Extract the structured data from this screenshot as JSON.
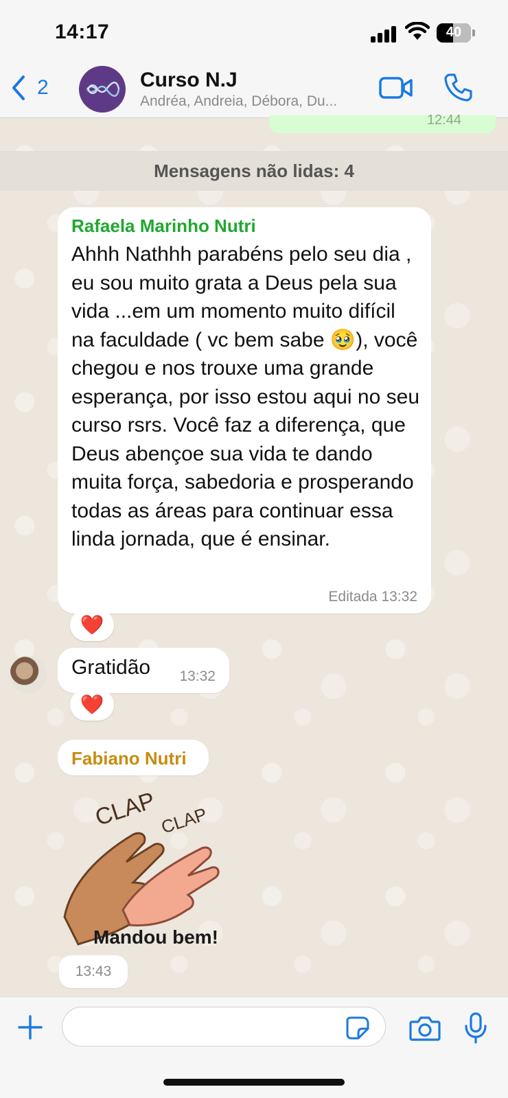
{
  "status_bar": {
    "time": "14:17",
    "battery": "40"
  },
  "header": {
    "back_count": "2",
    "title": "Curso N.J",
    "members": "Andréa, Andreia, Débora, Du..."
  },
  "previous_message": {
    "time": "12:44"
  },
  "unread_label": "Mensagens não lidas: 4",
  "messages": [
    {
      "sender": "Rafaela Marinho Nutri",
      "sender_color": "#1fa82e",
      "text": "Ahhh Nathhh parabéns pelo seu dia , eu sou muito grata a Deus pela sua vida ...em um momento muito difícil na  faculdade ( vc bem sabe 🥹), você chegou e nos trouxe uma grande esperança, por isso estou aqui no seu curso rsrs. Você faz a diferença, que Deus abençoe sua vida te dando muita força, sabedoria e prosperando todas as áreas para continuar essa linda jornada, que é ensinar.",
      "meta": "Editada 13:32",
      "reaction": "❤️"
    },
    {
      "text": "Gratidão",
      "meta": "13:32",
      "reaction": "❤️"
    },
    {
      "sender": "Fabiano Nutri",
      "sender_color": "#c78c12",
      "sticker": {
        "clap_1": "CLAP",
        "clap_2": "CLAP",
        "caption": "Mandou bem!"
      },
      "meta": "13:43"
    }
  ],
  "input": {
    "placeholder": ""
  },
  "colors": {
    "accent": "#1a7ae0",
    "outgoing_bubble": "#d9fdd3",
    "incoming_bubble": "#ffffff"
  }
}
